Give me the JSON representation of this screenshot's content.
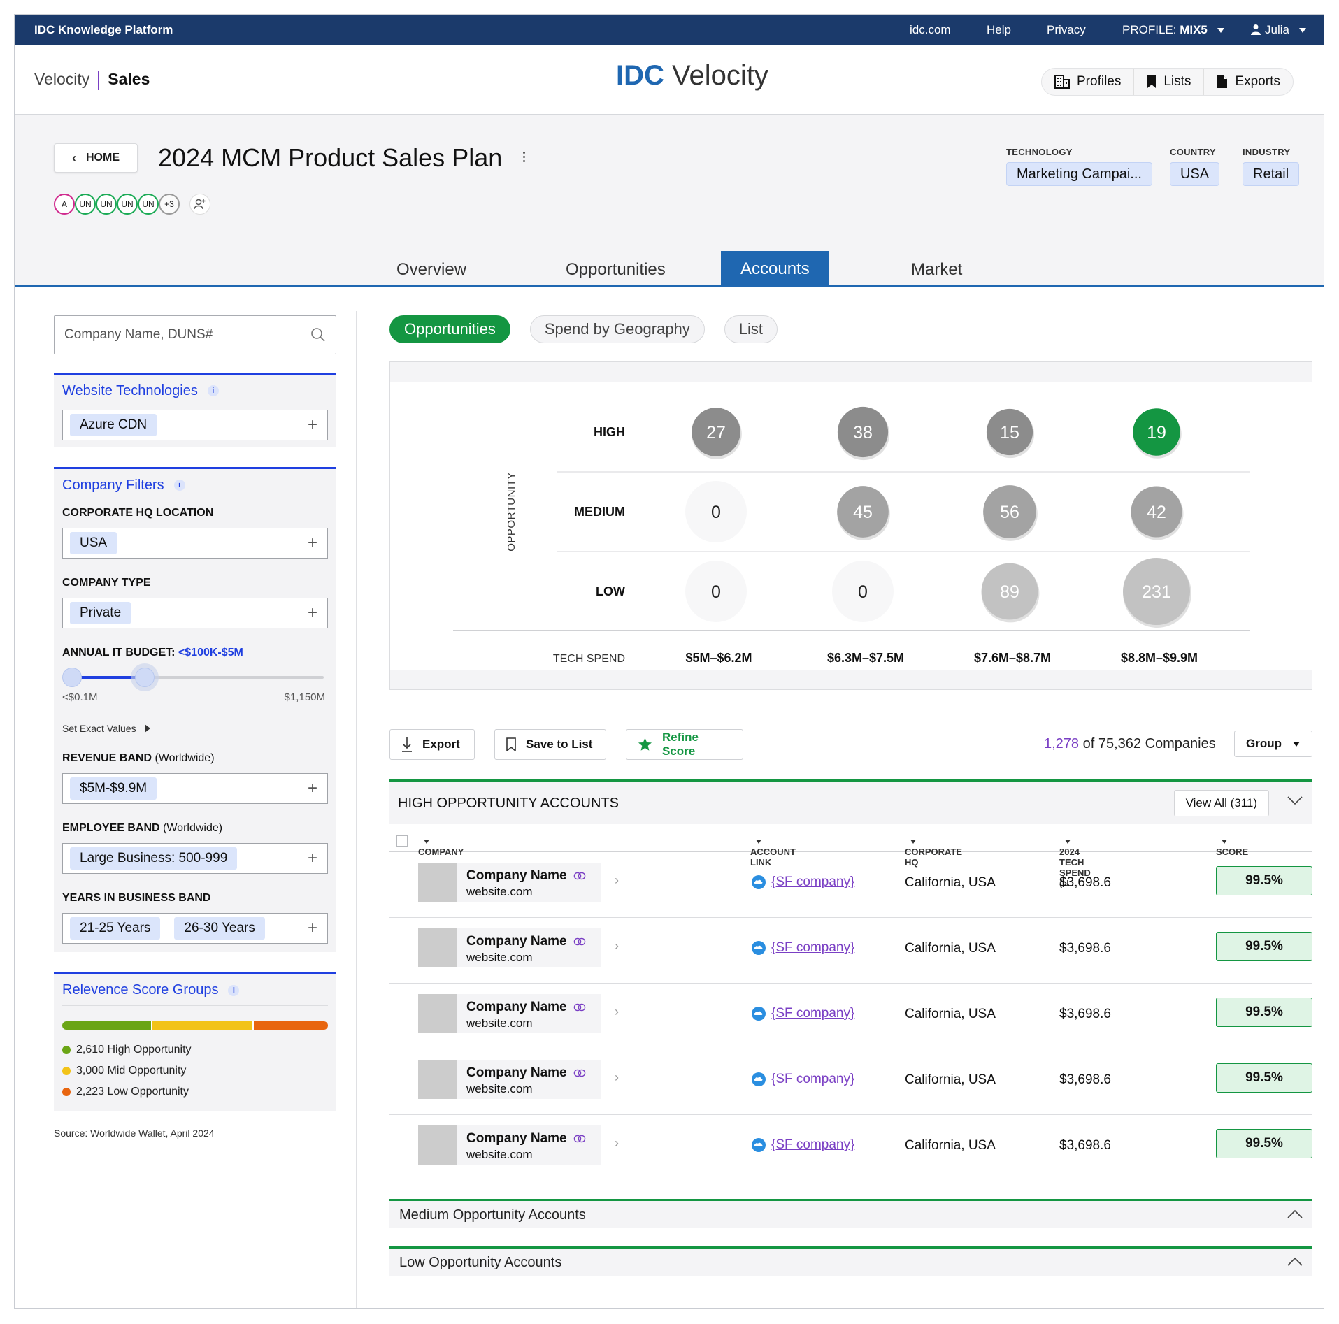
{
  "topbar": {
    "brand": "IDC Knowledge Platform",
    "links": [
      "idc.com",
      "Help",
      "Privacy"
    ],
    "profile_prefix": "PROFILE: ",
    "profile_value": "MIX5",
    "user": "Julia"
  },
  "header": {
    "breadcrumb_root": "Velocity",
    "breadcrumb_current": "Sales",
    "logo_brand": "IDC",
    "logo_product": "Velocity",
    "buttons": [
      "Profiles",
      "Lists",
      "Exports"
    ]
  },
  "plan": {
    "home_label": "HOME",
    "title": "2024 MCM Product Sales Plan",
    "avatars": [
      "A",
      "UN",
      "UN",
      "UN",
      "UN",
      "+3"
    ],
    "context": [
      {
        "label": "TECHNOLOGY",
        "value": "Marketing Campai..."
      },
      {
        "label": "COUNTRY",
        "value": "USA"
      },
      {
        "label": "INDUSTRY",
        "value": "Retail"
      }
    ],
    "tabs": [
      "Overview",
      "Opportunities",
      "Accounts",
      "Market"
    ],
    "active_tab": "Accounts"
  },
  "filters": {
    "search_placeholder": "Company Name, DUNS#",
    "website_tech_title": "Website Technologies",
    "website_tech_tags": [
      "Azure CDN"
    ],
    "company_filters_title": "Company Filters",
    "hq_label": "CORPORATE HQ LOCATION",
    "hq_tags": [
      "USA"
    ],
    "type_label": "COMPANY TYPE",
    "type_tags": [
      "Private"
    ],
    "budget_label": "ANNUAL IT BUDGET: ",
    "budget_value": "<$100K-$5M",
    "budget_min": "<$0.1M",
    "budget_max": "$1,150M",
    "set_exact": "Set Exact Values",
    "revenue_label": "REVENUE BAND",
    "revenue_scope": "(Worldwide)",
    "revenue_tags": [
      "$5M-$9.9M"
    ],
    "employee_label": "EMPLOYEE BAND",
    "employee_scope": "(Worldwide)",
    "employee_tags": [
      "Large Business: 500-999"
    ],
    "years_label": "YEARS IN BUSINESS BAND",
    "years_tags": [
      "21-25 Years",
      "26-30 Years"
    ],
    "relevance_title": "Relevence Score Groups",
    "relevance_groups": [
      {
        "label": "2,610 High Opportunity",
        "color": "#6aa515",
        "value": 2610
      },
      {
        "label": "3,000 Mid Opportunity",
        "color": "#f2c318",
        "value": 3000
      },
      {
        "label": "2,223 Low Opportunity",
        "color": "#e8650f",
        "value": 2223
      }
    ],
    "source": "Source: Worldwide Wallet, April 2024"
  },
  "views": {
    "pills": [
      "Opportunities",
      "Spend by Geography",
      "List"
    ],
    "active": "Opportunities"
  },
  "chart_data": {
    "type": "bubble-matrix",
    "y_axis_label": "OPPORTUNITY",
    "x_axis_label": "TECH SPEND",
    "rows": [
      "HIGH",
      "MEDIUM",
      "LOW"
    ],
    "columns": [
      "$5M–$6.2M",
      "$6.3M–$7.5M",
      "$7.6M–$8.7M",
      "$8.8M–$9.9M"
    ],
    "values": [
      [
        27,
        38,
        15,
        19
      ],
      [
        0,
        45,
        56,
        42
      ],
      [
        0,
        0,
        89,
        231
      ]
    ],
    "highlight": {
      "row": 0,
      "col": 3,
      "color": "#149642"
    },
    "colors": {
      "high": "#8c8c8c",
      "medium": "#a3a3a3",
      "low": "#c2c2c2"
    }
  },
  "toolbar": {
    "export": "Export",
    "save": "Save to List",
    "refine": "Refine Score",
    "count_num": "1,278",
    "count_rest": " of 75,362 Companies",
    "group": "Group"
  },
  "high_accounts": {
    "title": "HIGH OPPORTUNITY ACCOUNTS",
    "view_all": "View All (311)",
    "columns": [
      "COMPANY",
      "ACCOUNT LINK",
      "CORPORATE HQ",
      "2024 TECH SPEND (U...",
      "SCORE"
    ],
    "rows": [
      {
        "name": "Company Name",
        "site": "website.com",
        "link": "{SF company}",
        "hq": "California, USA",
        "spend": "$3,698.6",
        "score": "99.5%"
      },
      {
        "name": "Company Name",
        "site": "website.com",
        "link": "{SF company}",
        "hq": "California, USA",
        "spend": "$3,698.6",
        "score": "99.5%"
      },
      {
        "name": "Company Name",
        "site": "website.com",
        "link": "{SF company}",
        "hq": "California, USA",
        "spend": "$3,698.6",
        "score": "99.5%"
      },
      {
        "name": "Company Name",
        "site": "website.com",
        "link": "{SF company}",
        "hq": "California, USA",
        "spend": "$3,698.6",
        "score": "99.5%"
      },
      {
        "name": "Company Name",
        "site": "website.com",
        "link": "{SF company}",
        "hq": "California, USA",
        "spend": "$3,698.6",
        "score": "99.5%"
      }
    ]
  },
  "other_accounts": [
    "Medium Opportunity Accounts",
    "Low Opportunity Accounts"
  ]
}
